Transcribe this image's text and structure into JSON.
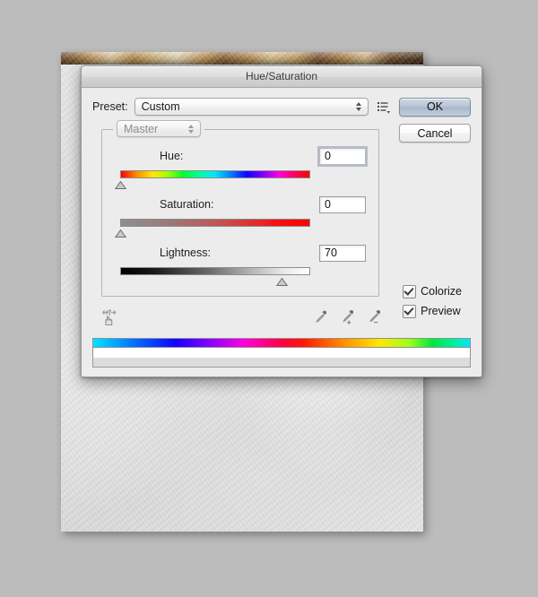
{
  "window": {
    "title": "Hue/Saturation"
  },
  "preset": {
    "label": "Preset:",
    "value": "Custom",
    "menu_icon": "preset-menu-icon"
  },
  "buttons": {
    "ok": "OK",
    "cancel": "Cancel"
  },
  "channel": {
    "value": "Master"
  },
  "sliders": [
    {
      "label": "Hue:",
      "value": "0",
      "thumb_percent": 0,
      "focused": true,
      "gradient": "linear-gradient(90deg,#ff0000 0%,#ff8a00 8%,#ffe800 17%,#9cff00 25%,#00ff2a 33%,#00ffa0 42%,#00e5ff 50%,#0080ff 58%,#1400ff 67%,#7a00ff 75%,#ff00e0 84%,#ff0060 92%,#ff0000 100%)"
    },
    {
      "label": "Saturation:",
      "value": "0",
      "thumb_percent": 0,
      "focused": false,
      "gradient": "linear-gradient(90deg,#8f8f8f 0%,#9a7a7a 25%,#c65050 55%,#f41414 82%,#ff0000 100%)"
    },
    {
      "label": "Lightness:",
      "value": "70",
      "thumb_percent": 85,
      "focused": false,
      "gradient": "linear-gradient(90deg,#000000 0%,#1a1a1a 18%,#6e6e6e 48%,#b8b8b8 70%,#e8e8e8 86%,#ffffff 100%)"
    }
  ],
  "tools": {
    "scrubby_icon": "scrubby-hand-icon",
    "eyedroppers": [
      {
        "name": "eyedropper-icon"
      },
      {
        "name": "eyedropper-add-icon"
      },
      {
        "name": "eyedropper-subtract-icon"
      }
    ]
  },
  "checkboxes": [
    {
      "label": "Colorize",
      "checked": true
    },
    {
      "label": "Preview",
      "checked": true
    }
  ],
  "colors": {
    "dialog_background": "#ececec",
    "default_button": "#b9c6d6",
    "desktop": "#bcbcbc"
  }
}
